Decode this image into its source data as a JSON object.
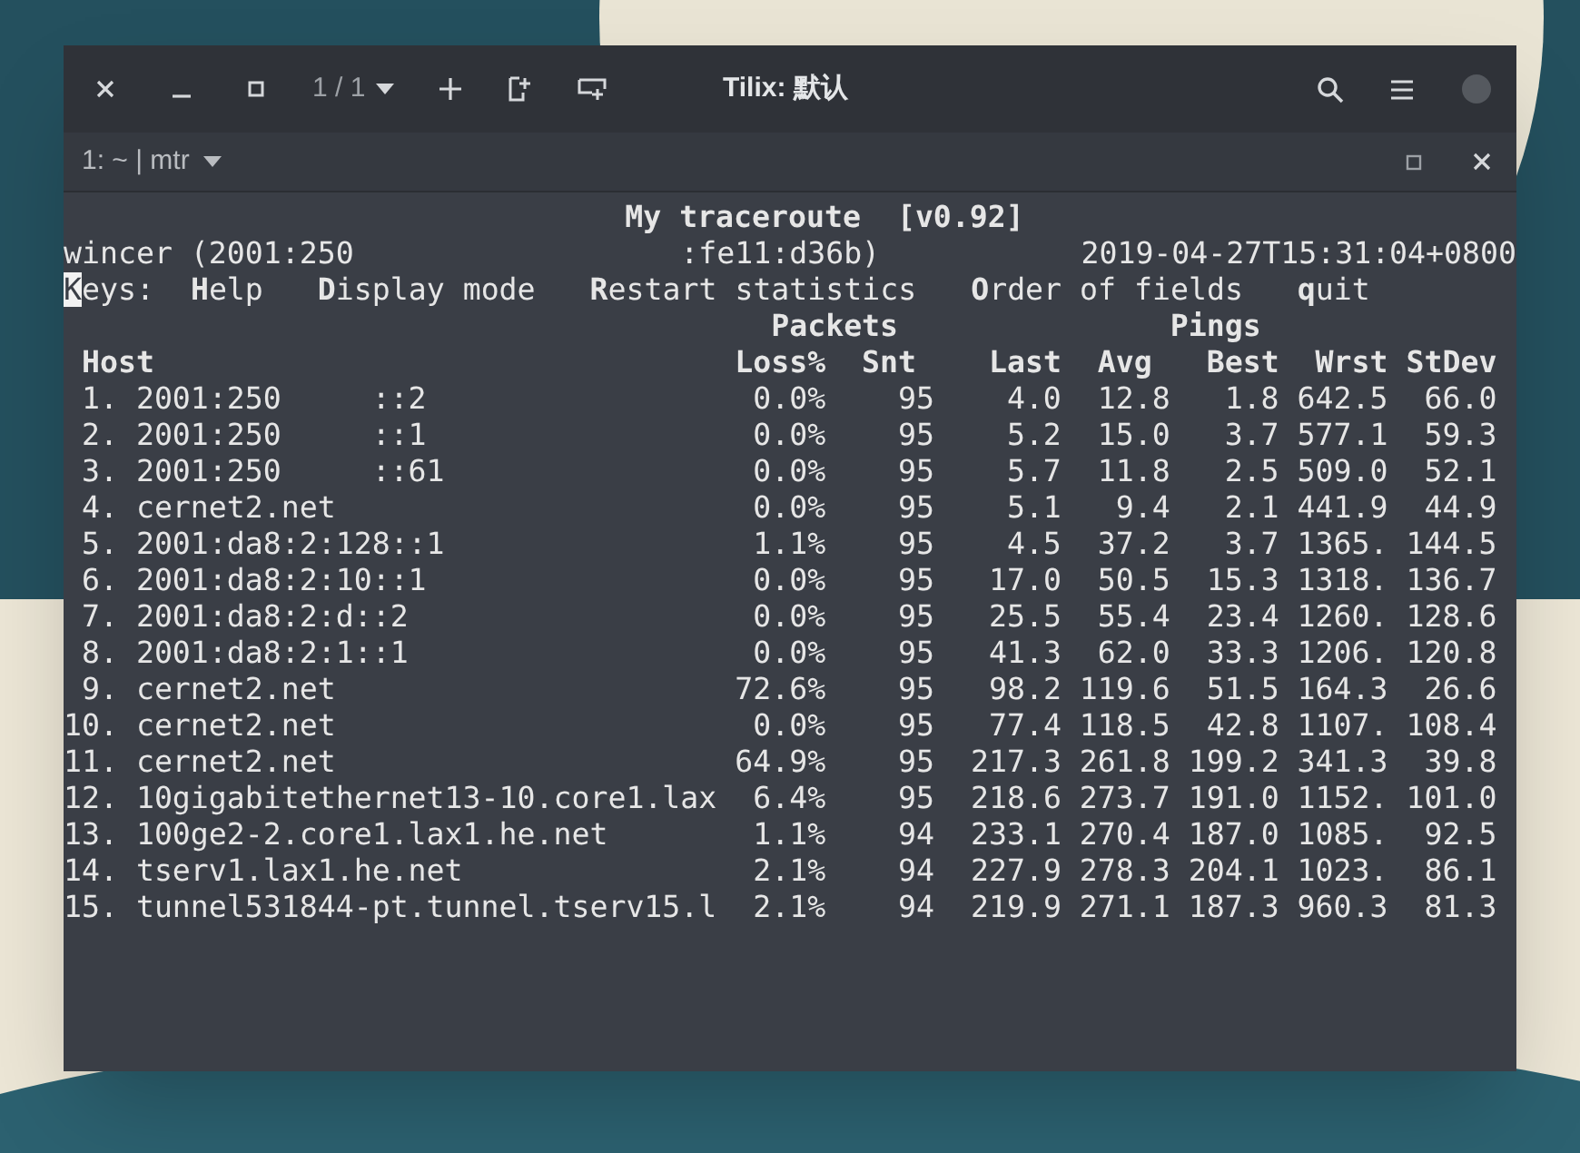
{
  "window": {
    "title": "Tilix: 默认",
    "page_counter": "1 / 1"
  },
  "session": {
    "label": "1: ~ | mtr"
  },
  "terminal": {
    "title": "My traceroute  [v0.92]",
    "host_prefix": "wincer (2001:250",
    "host_suffix": ":fe11:d36b)",
    "timestamp": "2019-04-27T15:31:04+0800",
    "cursor_on_first_char": true,
    "keys_label": "Keys:",
    "keys": [
      "**H**elp",
      "**D**isplay mode",
      "**R**estart statistics",
      "**O**rder of fields",
      "**q**uit"
    ],
    "groups": [
      "Packets",
      "Pings"
    ],
    "columns": [
      "Host",
      "Loss%",
      "Snt",
      "Last",
      "Avg",
      "Best",
      "Wrst",
      "StDev"
    ],
    "rows": [
      {
        "num": "1.",
        "host": "2001:250",
        "host_suffix": "::2",
        "values": [
          "0.0%",
          "95",
          "4.0",
          "12.8",
          "1.8",
          "642.5",
          "66.0"
        ]
      },
      {
        "num": "2.",
        "host": "2001:250",
        "host_suffix": "::1",
        "values": [
          "0.0%",
          "95",
          "5.2",
          "15.0",
          "3.7",
          "577.1",
          "59.3"
        ]
      },
      {
        "num": "3.",
        "host": "2001:250",
        "host_suffix": "::61",
        "values": [
          "0.0%",
          "95",
          "5.7",
          "11.8",
          "2.5",
          "509.0",
          "52.1"
        ]
      },
      {
        "num": "4.",
        "host": "cernet2.net",
        "values": [
          "0.0%",
          "95",
          "5.1",
          "9.4",
          "2.1",
          "441.9",
          "44.9"
        ]
      },
      {
        "num": "5.",
        "host": "2001:da8:2:128::1",
        "values": [
          "1.1%",
          "95",
          "4.5",
          "37.2",
          "3.7",
          "1365.",
          "144.5"
        ]
      },
      {
        "num": "6.",
        "host": "2001:da8:2:10::1",
        "values": [
          "0.0%",
          "95",
          "17.0",
          "50.5",
          "15.3",
          "1318.",
          "136.7"
        ]
      },
      {
        "num": "7.",
        "host": "2001:da8:2:d::2",
        "values": [
          "0.0%",
          "95",
          "25.5",
          "55.4",
          "23.4",
          "1260.",
          "128.6"
        ]
      },
      {
        "num": "8.",
        "host": "2001:da8:2:1::1",
        "values": [
          "0.0%",
          "95",
          "41.3",
          "62.0",
          "33.3",
          "1206.",
          "120.8"
        ]
      },
      {
        "num": "9.",
        "host": "cernet2.net",
        "values": [
          "72.6%",
          "95",
          "98.2",
          "119.6",
          "51.5",
          "164.3",
          "26.6"
        ]
      },
      {
        "num": "10.",
        "host": "cernet2.net",
        "values": [
          "0.0%",
          "95",
          "77.4",
          "118.5",
          "42.8",
          "1107.",
          "108.4"
        ]
      },
      {
        "num": "11.",
        "host": "cernet2.net",
        "values": [
          "64.9%",
          "95",
          "217.3",
          "261.8",
          "199.2",
          "341.3",
          "39.8"
        ]
      },
      {
        "num": "12.",
        "host": "10gigabitethernet13-10.core1.lax",
        "values": [
          "6.4%",
          "95",
          "218.6",
          "273.7",
          "191.0",
          "1152.",
          "101.0"
        ]
      },
      {
        "num": "13.",
        "host": "100ge2-2.core1.lax1.he.net",
        "values": [
          "1.1%",
          "94",
          "233.1",
          "270.4",
          "187.0",
          "1085.",
          "92.5"
        ]
      },
      {
        "num": "14.",
        "host": "tserv1.lax1.he.net",
        "values": [
          "2.1%",
          "94",
          "227.9",
          "278.3",
          "204.1",
          "1023.",
          "86.1"
        ]
      },
      {
        "num": "15.",
        "host": "tunnel531844-pt.tunnel.tserv15.l",
        "values": [
          "2.1%",
          "94",
          "219.9",
          "271.1",
          "187.3",
          "960.3",
          "81.3"
        ]
      }
    ]
  }
}
